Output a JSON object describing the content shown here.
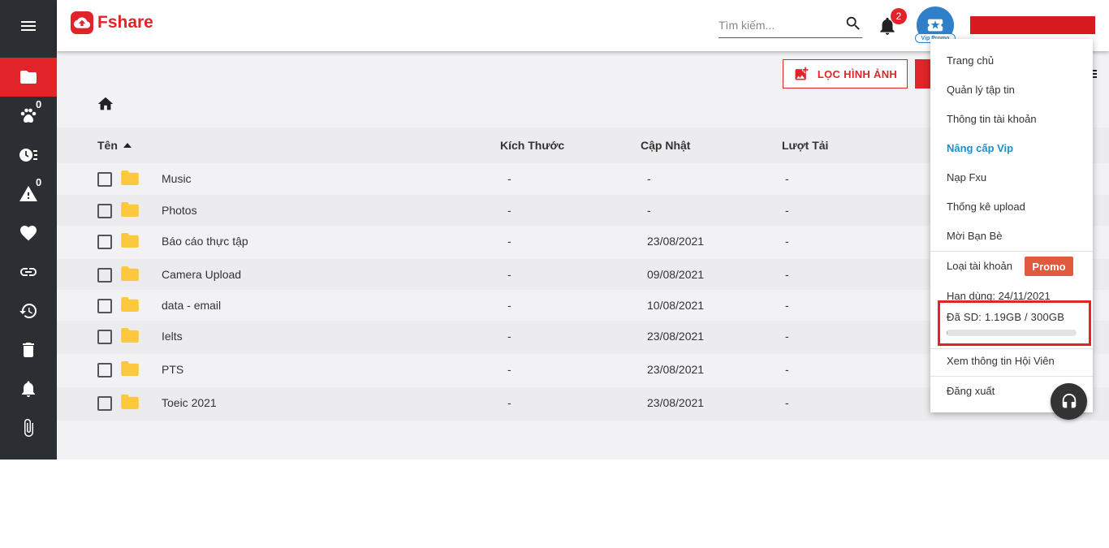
{
  "header": {
    "logo_text": "Fshare",
    "search_placeholder": "Tìm kiếm...",
    "notification_count": "2",
    "avatar_tag": "Vip Promo"
  },
  "sidebar": {
    "items": [
      {
        "icon": "folder-icon",
        "active": true
      },
      {
        "icon": "paw-icon",
        "badge": "0"
      },
      {
        "icon": "clock-list-icon"
      },
      {
        "icon": "warning-icon",
        "badge": "0"
      },
      {
        "icon": "heart-icon"
      },
      {
        "icon": "link-icon"
      },
      {
        "icon": "history-icon"
      },
      {
        "icon": "trash-icon"
      },
      {
        "icon": "bell-icon"
      },
      {
        "icon": "paperclip-icon"
      }
    ]
  },
  "toolbar": {
    "filter_images_label": "LỌC HÌNH ẢNH"
  },
  "table": {
    "headers": {
      "name": "Tên",
      "size": "Kích Thước",
      "updated": "Cập Nhật",
      "downloads": "Lượt Tải"
    },
    "rows": [
      {
        "name": "Music",
        "size": "-",
        "updated": "-",
        "downloads": "-"
      },
      {
        "name": "Photos",
        "size": "-",
        "updated": "-",
        "downloads": "-"
      },
      {
        "name": "Báo cáo thực tập",
        "size": "-",
        "updated": "23/08/2021",
        "downloads": "-"
      },
      {
        "name": "Camera Upload",
        "size": "-",
        "updated": "09/08/2021",
        "downloads": "-"
      },
      {
        "name": "data - email",
        "size": "-",
        "updated": "10/08/2021",
        "downloads": "-"
      },
      {
        "name": "Ielts",
        "size": "-",
        "updated": "23/08/2021",
        "downloads": "-"
      },
      {
        "name": "PTS",
        "size": "-",
        "updated": "23/08/2021",
        "downloads": "-"
      },
      {
        "name": "Toeic 2021",
        "size": "-",
        "updated": "23/08/2021",
        "downloads": "-"
      }
    ]
  },
  "menu": {
    "home": "Trang chủ",
    "files": "Quản lý tập tin",
    "account_info": "Thông tin tài khoản",
    "upgrade_vip": "Nâng cấp Vip",
    "topup": "Nạp Fxu",
    "upload_stats": "Thống kê upload",
    "invite": "Mời Bạn Bè",
    "account_type_label": "Loại tài khoản",
    "account_type_value": "Promo",
    "expiry": "Hạn dùng: 24/11/2021",
    "usage": "Đã SD: 1.19GB / 300GB",
    "usage_fraction": 0.004,
    "member_info": "Xem thông tin Hội Viên",
    "logout": "Đăng xuất"
  },
  "colors": {
    "brand_red": "#e0242a",
    "sidebar_bg": "#2b2e33",
    "folder_yellow": "#fcc93e",
    "vip_blue": "#1b8fd0",
    "promo_orange": "#e05a3f"
  }
}
